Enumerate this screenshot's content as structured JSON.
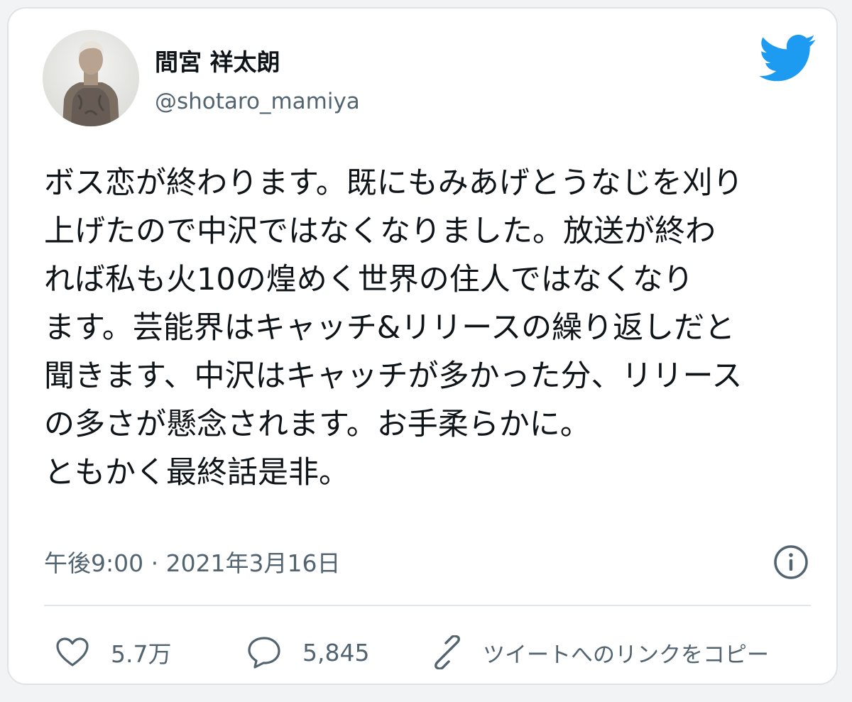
{
  "tweet": {
    "author": {
      "display_name": "間宮 祥太朗",
      "handle": "@shotaro_mamiya"
    },
    "text_lines": [
      "ボス恋が終わります。既にもみあげとうなじを刈り",
      "上げたので中沢ではなくなりました。放送が終わ",
      "れば私も火10の煌めく世界の住人ではなくなり",
      "ます。芸能界はキャッチ&リリースの繰り返しだと",
      "聞きます、中沢はキャッチが多かった分、リリース",
      "の多さが懸念されます。お手柔らかに。",
      "ともかく最終話是非。"
    ],
    "timestamp": "午後9:00 · 2021年3月16日",
    "actions": {
      "like_count": "5.7万",
      "reply_count": "5,845",
      "copy_link_label": "ツイートへのリンクをコピー"
    }
  },
  "icons": {
    "brand": "twitter-bird-icon",
    "info": "info-icon",
    "like": "heart-icon",
    "reply": "speech-bubble-icon",
    "copy": "link-icon"
  },
  "colors": {
    "brand_blue": "#1d9bf0",
    "text_primary": "#0f1419",
    "text_secondary": "#536471",
    "border": "#dfe3e8"
  }
}
